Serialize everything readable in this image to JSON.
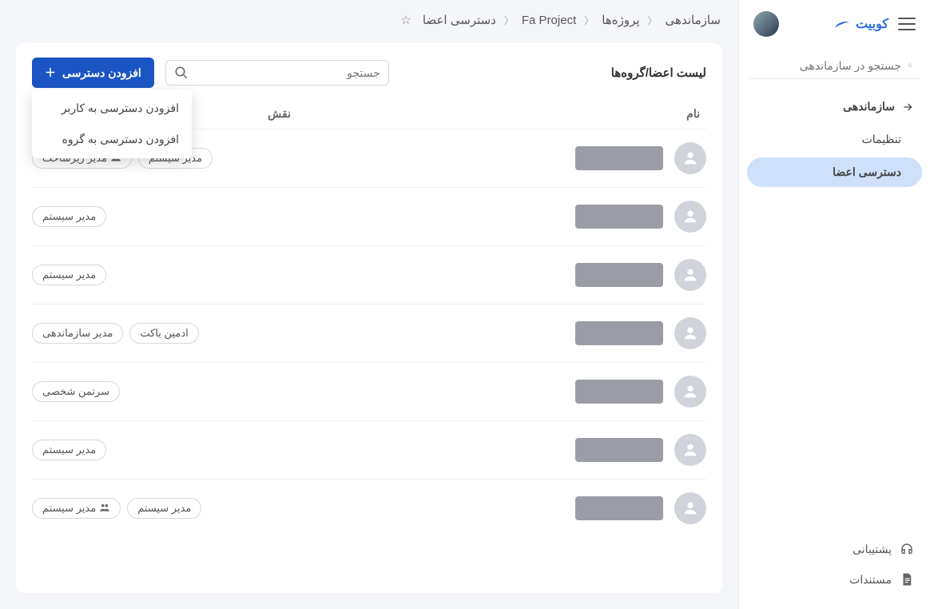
{
  "brand": "کوبیت",
  "sidebar_search_placeholder": "جستجو در سازماندهی",
  "nav": {
    "head": "سازماندهی",
    "items": [
      "تنظیمات",
      "دسترسی اعضا"
    ],
    "active_index": 1
  },
  "bottom": [
    "پشتیبانی",
    "مستندات"
  ],
  "breadcrumb": [
    "سازماندهی",
    "پروژه‌ها",
    "Fa Project",
    "دسترسی اعضا"
  ],
  "panel_title": "لیست اعضا/گروه‌ها",
  "search_placeholder": "جستجو",
  "add_button": "افزودن دسترسی",
  "dropdown": [
    "افزودن دسترسی به کاربر",
    "افزودن دسترسی به گروه"
  ],
  "columns": {
    "name": "نام",
    "role": "نقش"
  },
  "rows": [
    {
      "roles": [
        {
          "label": "مدیر زیرساخت",
          "group": true
        },
        {
          "label": "مدیر سیستم"
        }
      ]
    },
    {
      "roles": [
        {
          "label": "مدیر سیستم"
        }
      ]
    },
    {
      "roles": [
        {
          "label": "مدیر سیستم"
        }
      ]
    },
    {
      "roles": [
        {
          "label": "مدیر سازماندهی"
        },
        {
          "label": "ادمین باکت"
        }
      ]
    },
    {
      "roles": [
        {
          "label": "سرتمن شخصی"
        }
      ]
    },
    {
      "roles": [
        {
          "label": "مدیر سیستم"
        }
      ]
    },
    {
      "roles": [
        {
          "label": "مدیر سیستم",
          "group": true
        },
        {
          "label": "مدیر سیستم"
        }
      ]
    }
  ]
}
